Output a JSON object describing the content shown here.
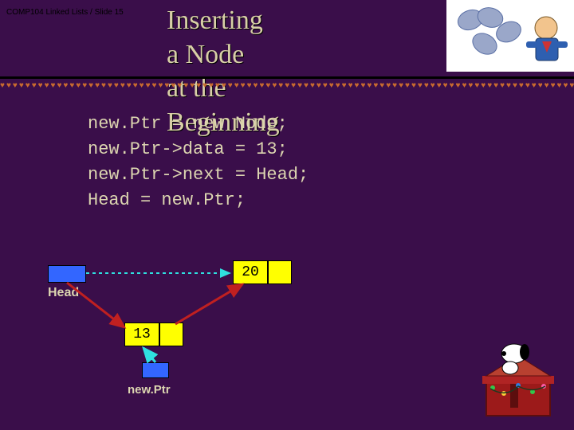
{
  "slide_ref": "COMP104 Linked Lists / Slide 15",
  "title_line1": "Inserting a Node",
  "title_line2": "at the Beginning",
  "code": {
    "l1": "new.Ptr = new Node;",
    "l2": "new.Ptr->data = 13;",
    "l3": "new.Ptr->next = Head;",
    "l4": "Head = new.Ptr;"
  },
  "diagram": {
    "head_label": "Head",
    "node1_value": "20",
    "node2_value": "13",
    "newptr_label": "new.Ptr"
  },
  "hearts_row": "♥♥♥♥♥♥♥♥♥♥♥♥♥♥♥♥♥♥♥♥♥♥♥♥♥♥♥♥♥♥♥♥♥♥♥♥♥♥♥♥♥♥♥♥♥♥♥♥♥♥♥♥♥♥♥♥♥♥♥♥♥♥♥♥♥♥♥♥♥♥♥♥♥♥♥♥♥♥♥♥♥♥♥♥♥♥♥♥♥♥♥♥♥♥♥♥♥♥♥♥♥♥♥♥♥♥"
}
